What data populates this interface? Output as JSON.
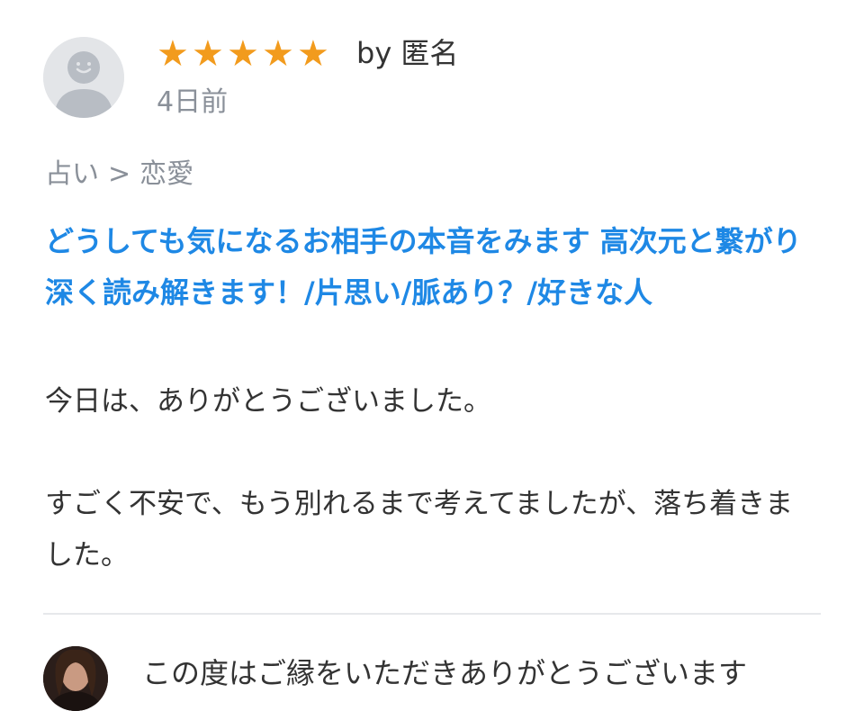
{
  "review": {
    "rating": 5,
    "max_rating": 5,
    "star_color": "#f29b1d",
    "author": "by 匿名",
    "date": "4日前",
    "avatar_icon": "default-user-icon",
    "category": {
      "parent": "占い",
      "separator": ">",
      "child": "恋愛"
    },
    "service_title": "どうしても気になるお相手の本音をみます 高次元と繋がり深く読み解きます！/片思い/脈あり？/好きな人",
    "body_lines": [
      "今日は、ありがとうございました。",
      "",
      "すごく不安で、もう別れるまで考えてましたが、落ち着きました。"
    ]
  },
  "reply": {
    "avatar_icon": "seller-photo-avatar",
    "text": "この度はご縁をいただきありがとうございます"
  },
  "colors": {
    "link": "#1e88e5",
    "muted": "#8a9099",
    "text": "#333333",
    "divider": "#e6e8eb"
  }
}
